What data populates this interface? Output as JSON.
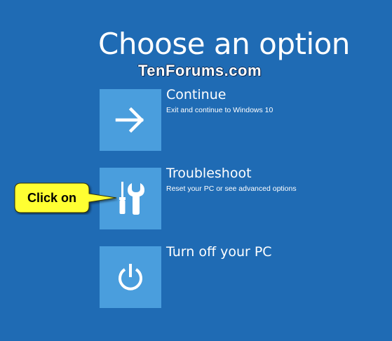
{
  "header": {
    "title": "Choose an option",
    "watermark": "TenForums.com"
  },
  "options": [
    {
      "title": "Continue",
      "description": "Exit and continue to Windows 10",
      "icon": "arrow-right-icon"
    },
    {
      "title": "Troubleshoot",
      "description": "Reset your PC or see advanced options",
      "icon": "tools-icon"
    },
    {
      "title": "Turn off your PC",
      "description": "",
      "icon": "power-icon"
    }
  ],
  "callout": {
    "text": "Click on",
    "color": "#ffff33"
  },
  "colors": {
    "background": "#1f6bb4",
    "tile": "#4a9edd"
  }
}
